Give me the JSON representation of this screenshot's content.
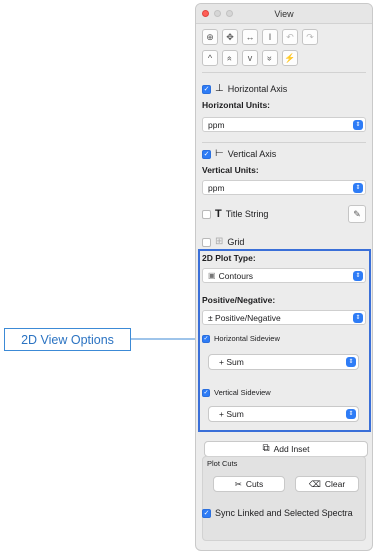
{
  "window": {
    "title": "View"
  },
  "toolbar": {
    "row1": [
      {
        "icon": "zoom-in-icon",
        "glyph": "⊕"
      },
      {
        "icon": "crosshair-move-icon",
        "glyph": "✥"
      },
      {
        "icon": "horizontal-fit-icon",
        "glyph": "↔"
      },
      {
        "icon": "vertical-fit-icon",
        "glyph": "I"
      },
      {
        "icon": "undo-view-icon",
        "glyph": "↶"
      },
      {
        "icon": "redo-view-icon",
        "glyph": "↷"
      }
    ],
    "row2": [
      {
        "icon": "chevron-up-icon",
        "glyph": "^"
      },
      {
        "icon": "double-chevron-up-icon",
        "glyph": "«"
      },
      {
        "icon": "chevron-down-icon",
        "glyph": "v"
      },
      {
        "icon": "double-chevron-down-icon",
        "glyph": "»"
      },
      {
        "icon": "auto-scale-icon",
        "glyph": "⚡"
      }
    ]
  },
  "axes": {
    "horizontal": {
      "checkbox_label": "Horizontal Axis",
      "checked": true,
      "units_label": "Horizontal Units:",
      "units_value": "ppm"
    },
    "vertical": {
      "checkbox_label": "Vertical Axis",
      "checked": true,
      "units_label": "Vertical Units:",
      "units_value": "ppm"
    }
  },
  "title_string": {
    "label": "Title String",
    "checked": false
  },
  "grid": {
    "label": "Grid",
    "checked": false
  },
  "plot_2d": {
    "type_label": "2D Plot Type:",
    "type_value": "Contours",
    "posneg_label": "Positive/Negative:",
    "posneg_value": "± Positive/Negative",
    "horizontal_sideview": {
      "label": "Horizontal Sideview",
      "checked": true,
      "value": "+ Sum"
    },
    "vertical_sideview": {
      "label": "Vertical Sideview",
      "checked": true,
      "value": "+ Sum"
    }
  },
  "add_inset": {
    "label": "Add Inset"
  },
  "plot_cuts": {
    "label": "Plot Cuts",
    "cuts_label": "Cuts",
    "clear_label": "Clear"
  },
  "sync": {
    "label": "Sync Linked and Selected Spectra",
    "checked": true
  },
  "callout": {
    "label": "2D View Options"
  },
  "colors": {
    "accent": "#2e7cf6",
    "highlight_border": "#3a6fd8",
    "callout_text": "#2b73c2"
  }
}
